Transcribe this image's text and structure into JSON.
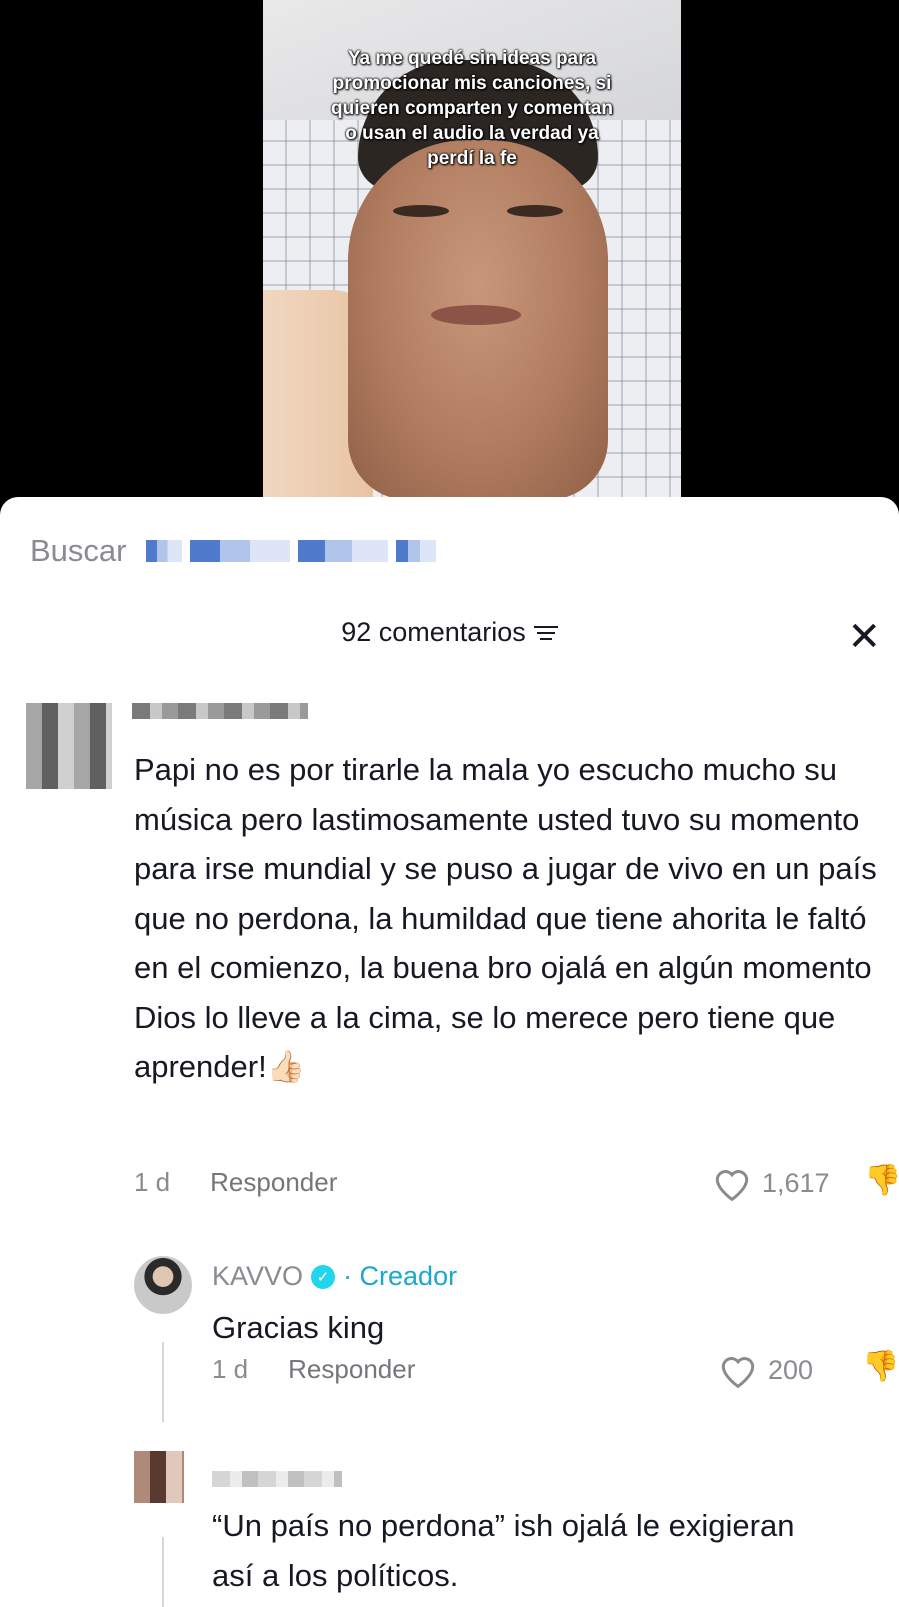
{
  "video": {
    "caption": "Ya me quedé sin ideas para promocionar mis canciones, si quieren comparten y comentan o usan el audio la verdad ya perdí la fe"
  },
  "search": {
    "label": "Buscar"
  },
  "comments_header": {
    "count_label": "92 comentarios"
  },
  "comments": [
    {
      "text": "Papi no es por tirarle la mala yo escucho mucho su música pero lastimosamente usted tuvo su momento para irse mundial y se puso a jugar de vivo en un país que no perdona, la humildad que tiene ahorita le faltó en el comienzo, la buena bro ojalá en algún momento Dios lo lleve a la cima, se lo merece pero tiene que aprender!👍🏻",
      "time": "1 d",
      "reply_label": "Responder",
      "likes": "1,617",
      "replies": [
        {
          "username": "KAVVO",
          "badge": "· Creador",
          "text": "Gracias king",
          "time": "1 d",
          "reply_label": "Responder",
          "likes": "200"
        },
        {
          "text": "“Un país no perdona” ish ojalá le exigieran así a los políticos."
        }
      ]
    }
  ],
  "icons": {
    "close": "close-icon",
    "filter": "filter-icon",
    "heart": "heart-icon",
    "dislike": "dislike-icon",
    "verified": "verified-icon"
  },
  "colors": {
    "text_primary": "#161823",
    "text_secondary": "#8a8b90",
    "creator_accent": "#1ba7cf",
    "verified_badge": "#20d5ec"
  }
}
